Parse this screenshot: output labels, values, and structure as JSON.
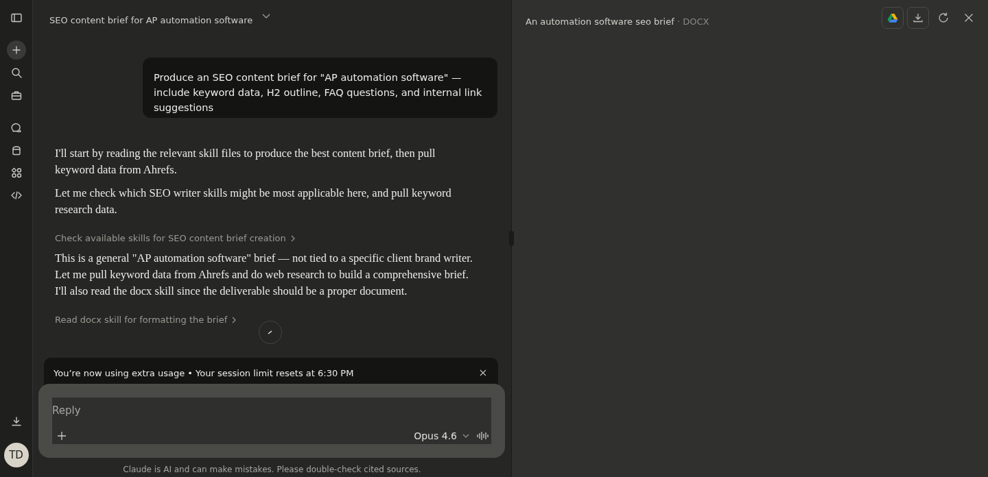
{
  "sidebar": {
    "avatar": "TD",
    "items": [
      {
        "kind": "toggle"
      },
      {
        "kind": "new"
      },
      {
        "kind": "search"
      },
      {
        "kind": "projects"
      },
      {
        "kind": "chats"
      },
      {
        "kind": "artifacts"
      },
      {
        "kind": "apps"
      },
      {
        "kind": "code"
      }
    ]
  },
  "chat": {
    "title": "SEO content brief for AP automation software",
    "messages": [
      {
        "kind": "user",
        "text": "Produce an SEO content brief for \"AP automation software\" — include keyword data, H2 outline, FAQ questions, and internal link suggestions"
      },
      {
        "kind": "assistant",
        "text": "I'll start by reading the relevant skill files to produce the best content brief, then pull keyword data from Ahrefs."
      },
      {
        "kind": "assistant",
        "text": "Let me check which SEO writer skills might be most applicable here, and pull keyword research data."
      },
      {
        "kind": "tool",
        "text": "Check available skills for SEO content brief creation"
      },
      {
        "kind": "assistant",
        "text": "This is a general \"AP automation software\" brief — not tied to a specific client brand writer. Let me pull keyword data from Ahrefs and do web research to build a comprehensive brief. I'll also read the docx skill since the deliverable should be a proper document."
      },
      {
        "kind": "tool",
        "text": "Read docx skill for formatting the brief"
      }
    ],
    "banner": "You’re now using extra usage • Your session limit resets at 6:30 PM",
    "composer": {
      "placeholder": "Reply",
      "model": "Opus 4.6"
    },
    "disclaimer": "Claude is AI and can make mistakes. Please double-check cited sources."
  },
  "document": {
    "title": "An automation software seo brief",
    "separator": "·",
    "format": "DOCX"
  }
}
